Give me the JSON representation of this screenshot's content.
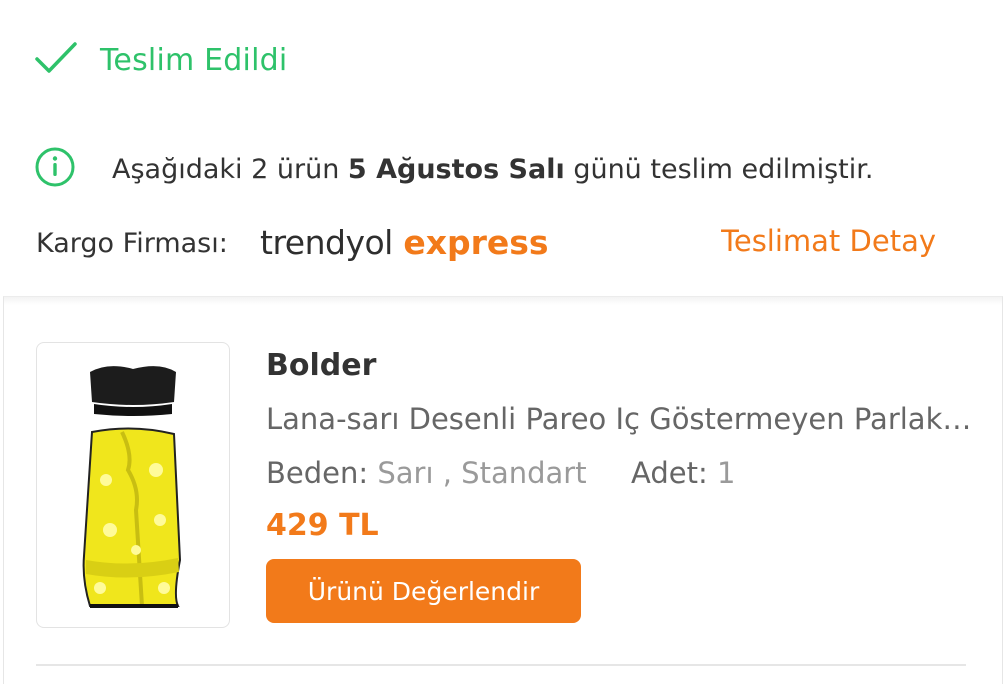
{
  "status": {
    "label": "Teslim Edildi",
    "icon": "check-icon",
    "color": "#2ec26a"
  },
  "delivery_info": {
    "icon": "info-icon",
    "prefix": "Aşağıdaki 2 ürün ",
    "date": "5 Ağustos Salı",
    "suffix": " günü teslim edilmiştir."
  },
  "cargo": {
    "label": "Kargo Firması:",
    "logo_brand": "trendyol",
    "logo_service": "express",
    "detail_link": "Teslimat Detay"
  },
  "product": {
    "image_icon": "swimwear-pareo-image",
    "brand": "Bolder",
    "title": "Lana-sarı Desenli Pareo Iç Göstermeyen Parlak Kumaş",
    "size_label": "Beden:",
    "size_value": "Sarı , Standart",
    "qty_label": "Adet:",
    "qty_value": "1",
    "price": "429 TL",
    "rate_button": "Ürünü Değerlendir"
  },
  "colors": {
    "accent": "#f27a1a",
    "success": "#2ec26a",
    "text": "#333333"
  }
}
